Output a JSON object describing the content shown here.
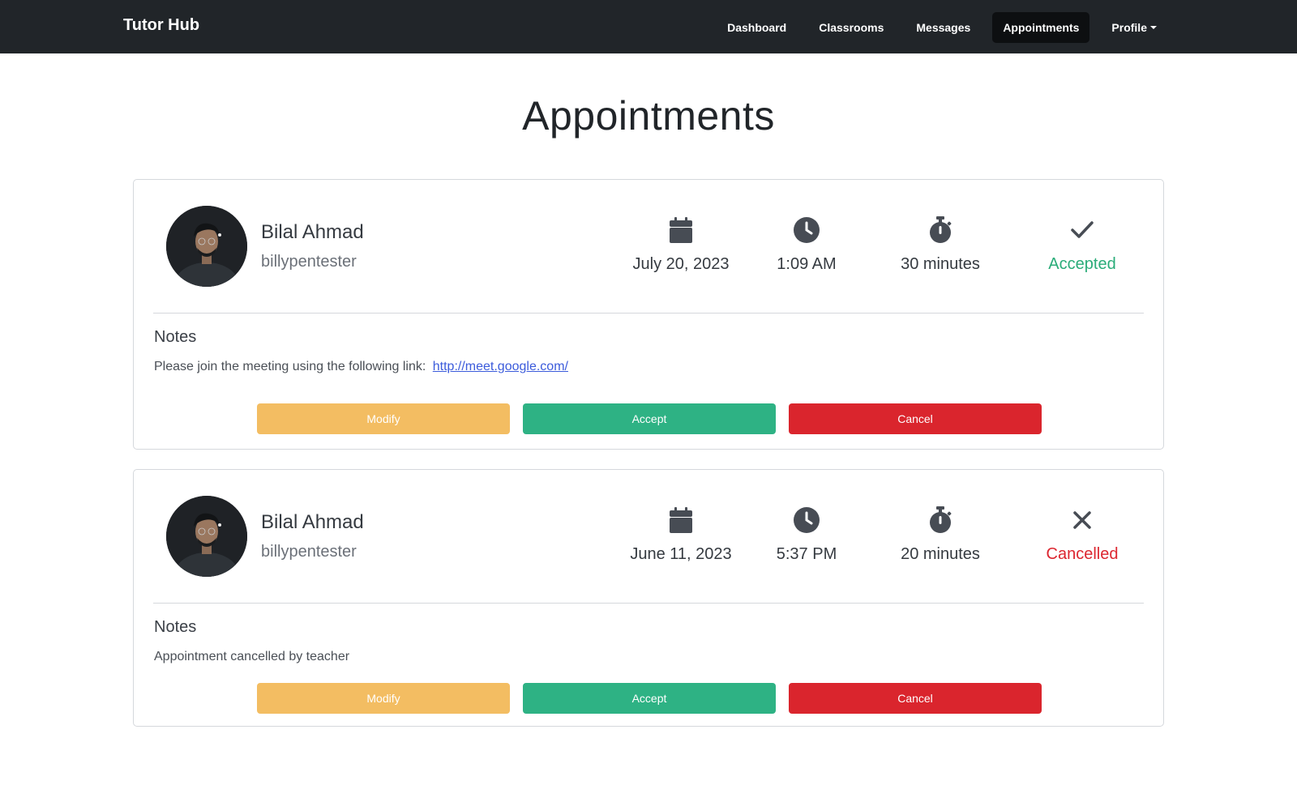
{
  "nav": {
    "brand": "Tutor Hub",
    "links": [
      "Dashboard",
      "Classrooms",
      "Messages",
      "Appointments",
      "Profile"
    ],
    "active": "Appointments"
  },
  "page": {
    "title": "Appointments"
  },
  "colors": {
    "accepted": "#2aac79",
    "cancelled": "#dc2630",
    "modify": "#f3bd62",
    "accept": "#2eb284",
    "cancel": "#da252d",
    "navbar": "#212529"
  },
  "appointments": [
    {
      "name": "Bilal Ahmad",
      "username": "billypentester",
      "date": "July 20, 2023",
      "time": "1:09 AM",
      "duration": "30 minutes",
      "status": "Accepted",
      "status_icon": "check-icon",
      "notes_label": "Notes",
      "notes_text": "Please join the meeting using the following link:",
      "notes_link": "http://meet.google.com/",
      "buttons": {
        "modify": "Modify",
        "accept": "Accept",
        "cancel": "Cancel"
      }
    },
    {
      "name": "Bilal Ahmad",
      "username": "billypentester",
      "date": "June 11, 2023",
      "time": "5:37 PM",
      "duration": "20 minutes",
      "status": "Cancelled",
      "status_icon": "x-icon",
      "notes_label": "Notes",
      "notes_text": "Appointment cancelled by teacher",
      "buttons": {
        "modify": "Modify",
        "accept": "Accept",
        "cancel": "Cancel"
      }
    }
  ]
}
